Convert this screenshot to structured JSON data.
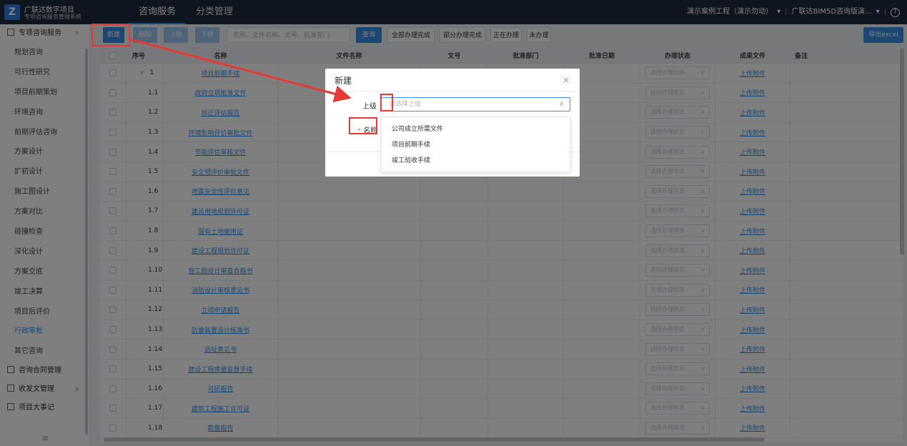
{
  "header": {
    "logo_line1": "广联达数字项目",
    "logo_line2": "专项咨询服务管理系统",
    "nav": [
      "咨询服务",
      "分类管理"
    ],
    "project": "演示案例工程（演示勿动）",
    "account": "广联达BIM5D咨询版演...",
    "help": "?"
  },
  "sidebar": {
    "group_main": "专项咨询服务",
    "items": [
      "规划咨询",
      "可行性研究",
      "项目前期策划",
      "环境咨询",
      "前期评估咨询",
      "方案设计",
      "扩初设计",
      "施工图设计",
      "方案对比",
      "碰撞检查",
      "深化设计",
      "方案交底",
      "竣工决算",
      "项目后评价",
      "行政审批",
      "其它咨询"
    ],
    "active_item": "行政审批",
    "groups_bottom": [
      "咨询合同管理",
      "收发文管理",
      "项目大事记"
    ],
    "collapse": "≡"
  },
  "toolbar": {
    "new_label": "新建",
    "delete_label": "删除",
    "up_label": "上移",
    "down_label": "下移",
    "search_placeholder": "名称、文件名称、文号、批准部门",
    "query_label": "查询",
    "filters": [
      "全部办理完成",
      "部分办理完成",
      "正在办理",
      "未办理"
    ],
    "export_label": "导出excel"
  },
  "table": {
    "columns": [
      "序号",
      "名称",
      "文件名称",
      "文号",
      "批准部门",
      "批准日期",
      "办理状态",
      "成果文件",
      "备注"
    ],
    "status_placeholder": "选择办理状态",
    "upload_label": "上传附件",
    "rows": [
      {
        "seq": "1",
        "name": "项目前期手续"
      },
      {
        "seq": "1.1",
        "name": "政府立项批准文件"
      },
      {
        "seq": "1.2",
        "name": "拆迁评估报告"
      },
      {
        "seq": "1.3",
        "name": "环境影响评价审批文件"
      },
      {
        "seq": "1.4",
        "name": "节能评估审核文件"
      },
      {
        "seq": "1.5",
        "name": "安全预评价审批文件"
      },
      {
        "seq": "1.6",
        "name": "地震安全性评价意见"
      },
      {
        "seq": "1.7",
        "name": "建设用地规划许可证"
      },
      {
        "seq": "1.8",
        "name": "国有土地使用证"
      },
      {
        "seq": "1.9",
        "name": "建设工程规划许可证"
      },
      {
        "seq": "1.10",
        "name": "施工图设计审查合格书"
      },
      {
        "seq": "1.11",
        "name": "消防设计审核意见书"
      },
      {
        "seq": "1.12",
        "name": "立项申请报告"
      },
      {
        "seq": "1.13",
        "name": "防雷装置设计核准书"
      },
      {
        "seq": "1.14",
        "name": "选址意见书"
      },
      {
        "seq": "1.15",
        "name": "建设工程质量监督手续"
      },
      {
        "seq": "1.16",
        "name": "可研报告"
      },
      {
        "seq": "1.17",
        "name": "建筑工程施工许可证"
      },
      {
        "seq": "1.18",
        "name": "勘察报告"
      }
    ]
  },
  "dialog": {
    "title": "新建",
    "close": "×",
    "parent_label": "上级",
    "parent_placeholder": "请选择上级",
    "name_required": "*",
    "name_label": "名称",
    "options": [
      "公司成立所需文件",
      "项目前期手续",
      "竣工验收手续"
    ]
  },
  "colors": {
    "accent": "#3a8ee6",
    "header_bg": "#1f2a3c",
    "annotation": "#e53935",
    "required": "#f56c6c"
  }
}
